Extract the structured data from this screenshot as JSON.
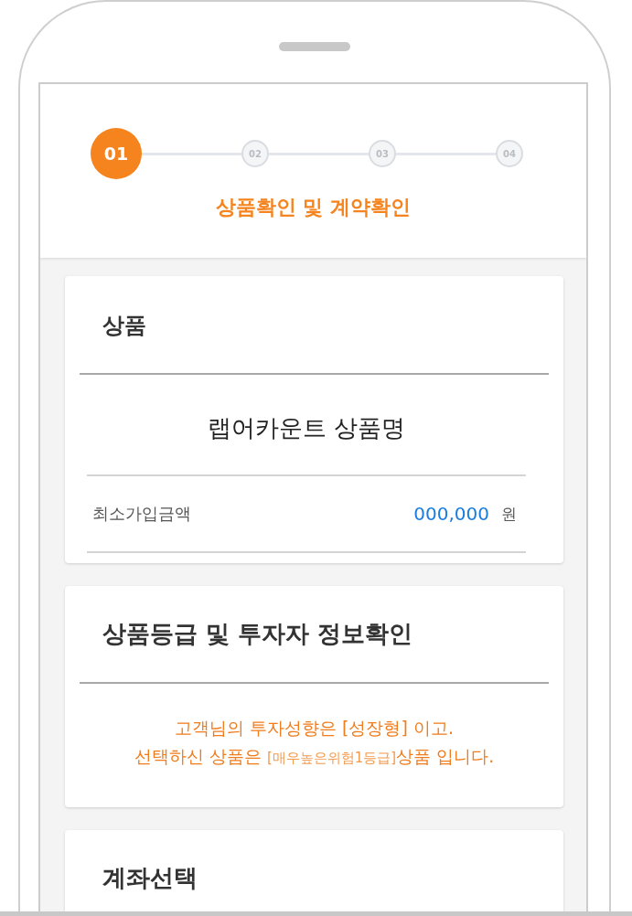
{
  "stepper": {
    "steps": [
      {
        "label": "01",
        "selected": true
      },
      {
        "label": "02",
        "selected": false
      },
      {
        "label": "03",
        "selected": false
      },
      {
        "label": "04",
        "selected": false
      }
    ],
    "title": "상품확인 및 계약확인"
  },
  "cards": [
    {
      "kind": "product",
      "title": "상품",
      "product_name": "랩어카운트 상품명",
      "rows": [
        {
          "label": "최소가입금액",
          "value": "000,000",
          "unit": "원"
        }
      ]
    },
    {
      "kind": "notice",
      "title": "상품등급 및 투자자 정보확인",
      "lines": [
        [
          {
            "kind": "plain",
            "text": "고객님의 투자성향은 [성장형] 이고."
          }
        ],
        [
          {
            "kind": "plain",
            "text": "선택하신 상품은 "
          },
          {
            "kind": "grade",
            "text": "[매우높은위험1등급]"
          },
          {
            "kind": "plain",
            "text": "상품 입니다."
          }
        ]
      ]
    },
    {
      "kind": "section",
      "title": "계좌선택"
    }
  ]
}
